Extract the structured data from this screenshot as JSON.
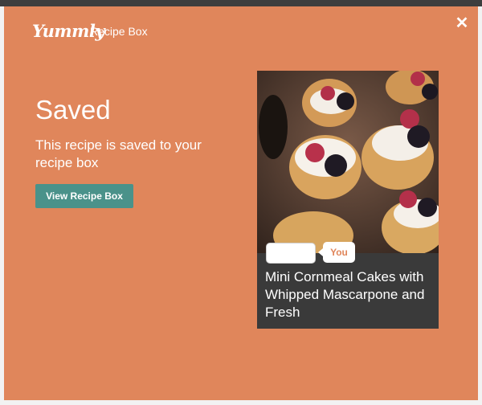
{
  "header": {
    "logo_text": "Yummly",
    "title": "Recipe Box",
    "close_label": "✕"
  },
  "main": {
    "status_title": "Saved",
    "status_description": "This recipe is saved to your recipe box",
    "view_button_label": "View Recipe Box"
  },
  "recipe_card": {
    "badge_you": "You",
    "title": "Mini Cornmeal Cakes with Whipped Mascarpone and Fresh"
  },
  "colors": {
    "modal_background": "#e0865b",
    "button_background": "#4a928a",
    "card_background": "#3a3a3a"
  }
}
